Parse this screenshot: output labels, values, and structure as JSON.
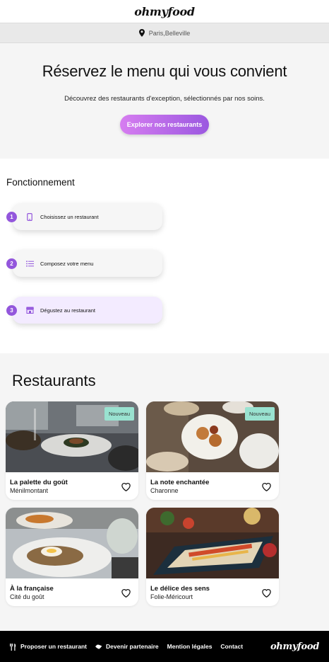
{
  "header": {
    "logo": "ohmyfood"
  },
  "location": {
    "text": "Paris,Belleville",
    "icon": "map-pin-icon"
  },
  "hero": {
    "title": "Réservez le menu qui vous convient",
    "subtitle": "Découvrez des restaurants d'exception, sélectionnés par nos soins.",
    "cta_label": "Explorer nos restaurants"
  },
  "howto": {
    "title": "Fonctionnement",
    "steps": [
      {
        "number": "1",
        "label": "Choisissez un restaurant",
        "icon": "mobile-phone-icon"
      },
      {
        "number": "2",
        "label": "Composez votre menu",
        "icon": "list-icon"
      },
      {
        "number": "3",
        "label": "Dégustez au restaurant",
        "icon": "store-icon"
      }
    ]
  },
  "restaurants": {
    "title": "Restaurants",
    "items": [
      {
        "name": "La palette du goût",
        "area": "Ménilmontant",
        "badge": "Nouveau"
      },
      {
        "name": "La note enchantée",
        "area": "Charonne",
        "badge": "Nouveau"
      },
      {
        "name": "À la française",
        "area": "Cité du goût",
        "badge": ""
      },
      {
        "name": "Le délice des sens",
        "area": "Folie-Méricourt",
        "badge": ""
      }
    ]
  },
  "footer": {
    "links": [
      {
        "label": "Proposer un restaurant",
        "icon": "utensils-icon"
      },
      {
        "label": "Devenir partenaire",
        "icon": "handshake-icon"
      },
      {
        "label": "Mention légales"
      },
      {
        "label": "Contact"
      }
    ],
    "logo": "ohmyfood"
  },
  "colors": {
    "accent": "#9356dc",
    "cta_start": "#d67df0",
    "cta_end": "#9b58e0",
    "badge": "#99e2d0"
  }
}
